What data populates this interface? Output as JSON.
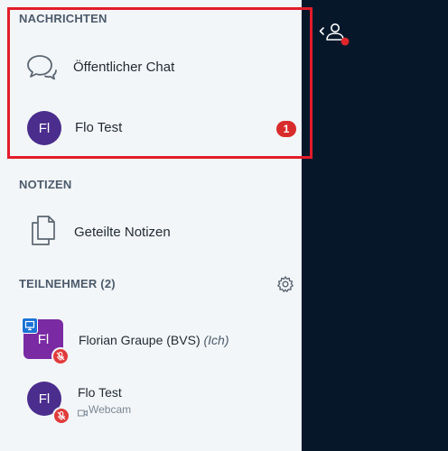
{
  "messages": {
    "header": "NACHRICHTEN",
    "public_chat_label": "Öffentlicher Chat",
    "private_chat": {
      "avatar_initials": "Fl",
      "name": "Flo Test",
      "unread_count": "1"
    }
  },
  "notes": {
    "header": "NOTIZEN",
    "shared_notes_label": "Geteilte Notizen"
  },
  "participants": {
    "header": "TEILNEHMER (2)",
    "settings_icon": "gear-icon",
    "list": [
      {
        "avatar_initials": "Fl",
        "name": "Florian Graupe (BVS)",
        "self_tag": "(Ich)",
        "presenter": true,
        "muted": true
      },
      {
        "avatar_initials": "Fl",
        "name": "Flo Test",
        "status": "Webcam",
        "muted": true
      }
    ]
  },
  "colors": {
    "sidebar_bg": "#f3f6f9",
    "main_bg": "#06172a",
    "highlight": "#e21c2a",
    "badge_red": "#d82c2c",
    "avatar_purple_dark": "#4a2d8c",
    "avatar_purple": "#7a2aa3",
    "presenter_blue": "#1a73d6"
  }
}
